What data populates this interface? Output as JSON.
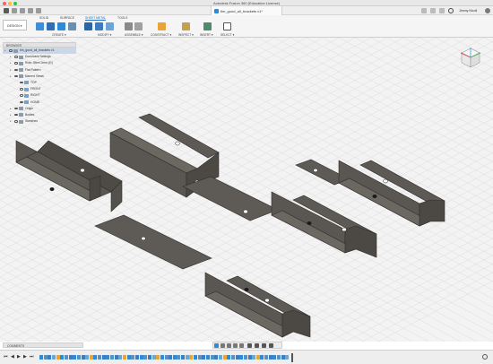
{
  "window": {
    "title": "Autodesk Fusion 360 (Education License)",
    "doc_tab": "tim_good_all_brackets v1*",
    "user": "Jimmy Nicoll"
  },
  "ribbon": {
    "design_label": "DESIGN ▾",
    "tabs": [
      "SOLID",
      "SURFACE",
      "SHEET METAL",
      "TOOLS"
    ],
    "active_tab": "SHEET METAL",
    "groups": [
      "CREATE ▾",
      "MODIFY ▾",
      "ASSEMBLE ▾",
      "CONSTRUCT ▾",
      "INSPECT ▾",
      "INSERT ▾",
      "SELECT ▾"
    ]
  },
  "browser": {
    "header": "BROWSER",
    "items": [
      {
        "label": "tim_good_all_brackets v1",
        "indent": 0,
        "selected": true
      },
      {
        "label": "Document Settings",
        "indent": 1
      },
      {
        "label": "Rule: Steel 2mm (D)",
        "indent": 1
      },
      {
        "label": "Flat Pattern",
        "indent": 1
      },
      {
        "label": "Named Views",
        "indent": 1
      },
      {
        "label": "TOP",
        "indent": 2
      },
      {
        "label": "FRONT",
        "indent": 2
      },
      {
        "label": "RIGHT",
        "indent": 2
      },
      {
        "label": "HOME",
        "indent": 2
      },
      {
        "label": "Origin",
        "indent": 1
      },
      {
        "label": "Bodies",
        "indent": 1
      },
      {
        "label": "Sketches",
        "indent": 1
      }
    ]
  },
  "comments": {
    "label": "COMMENTS"
  },
  "colors": {
    "accent": "#1f6fc4",
    "part_dark": "#4a4844",
    "part_mid": "#5d5a55",
    "part_light": "#706c66",
    "grid": "#dcdcdc"
  }
}
